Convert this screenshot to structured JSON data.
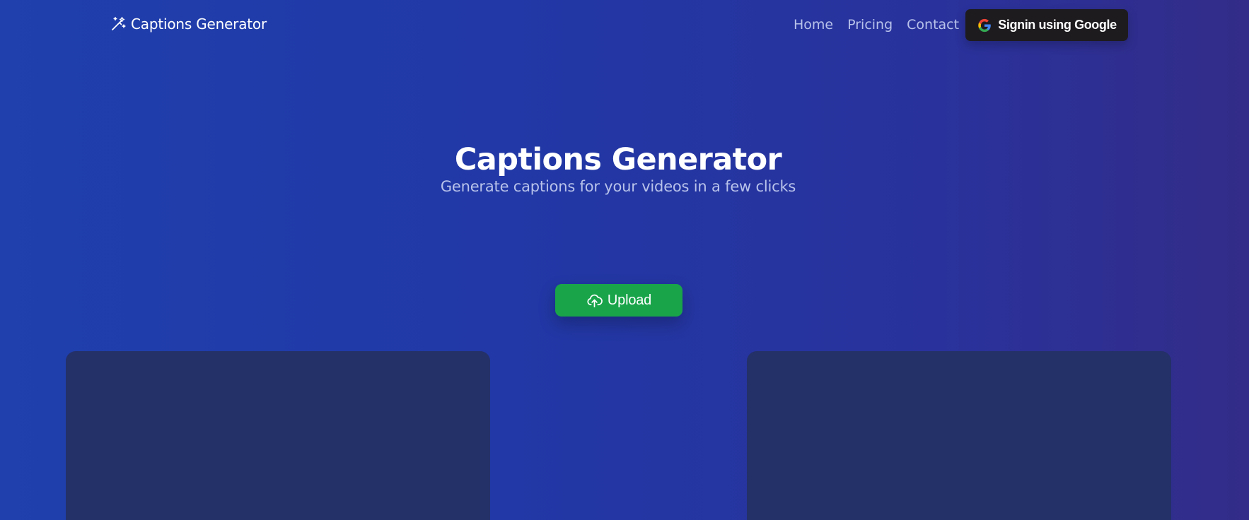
{
  "header": {
    "brand": {
      "label": "Captions Generator",
      "icon": "magic-wand-icon"
    },
    "nav": [
      {
        "label": "Home"
      },
      {
        "label": "Pricing"
      },
      {
        "label": "Contact"
      }
    ],
    "signin": {
      "label": "Signin using Google",
      "icon": "google-icon"
    }
  },
  "hero": {
    "title": "Captions Generator",
    "subtitle": "Generate captions for your videos in a few clicks"
  },
  "upload": {
    "label": "Upload",
    "icon": "cloud-upload-icon"
  },
  "theme": {
    "background_start": "#1f40ad",
    "background_end": "#332c88",
    "signin_button": "#1e1b1f",
    "upload_button": "#19a44a",
    "card_background": "#243068",
    "nav_text": "#b8c2ea"
  }
}
